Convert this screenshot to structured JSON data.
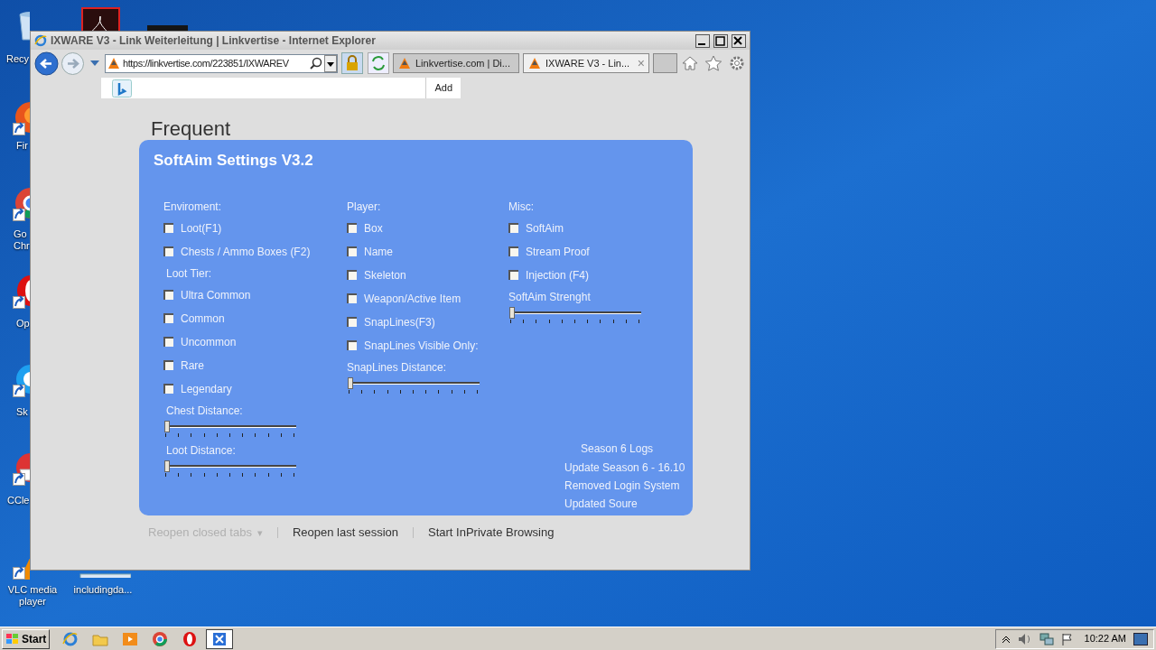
{
  "desktop": {
    "icons": [
      {
        "kind": "bin",
        "label": "Recy",
        "shortcut": false
      },
      {
        "kind": "pdf",
        "shortcut": false
      },
      {
        "kind": "dark",
        "shortcut": false
      },
      {
        "kind": "fox",
        "label": "Fir",
        "shortcut": true
      },
      {
        "kind": "ring",
        "label": "Go Chr",
        "shortcut": true
      },
      {
        "kind": "o",
        "label": "Op",
        "shortcut": true
      },
      {
        "kind": "bubble",
        "label": "Sk",
        "shortcut": true
      },
      {
        "kind": "broom",
        "label": "CCle",
        "shortcut": true
      },
      {
        "kind": "cone",
        "label": "VLC media player",
        "shortcut": true
      },
      {
        "kind": "document",
        "label": "includingda...",
        "shortcut": false
      }
    ]
  },
  "browser": {
    "title": "IXWARE V3 - Link Weiterleitung | Linkvertise - Internet Explorer",
    "address": "https://linkvertise.com/223851/IXWAREV",
    "tabs": [
      {
        "label": "Linkvertise.com | Di...",
        "selected": false
      },
      {
        "label": "IXWARE V3 - Lin...",
        "selected": true,
        "close": "×"
      }
    ],
    "search_bar": {
      "button": "Add"
    },
    "page": {
      "heading": "Frequent",
      "links": [
        {
          "label": "Reopen closed tabs",
          "disabled": true,
          "caret": "▾"
        },
        {
          "label": "Reopen last session",
          "disabled": false
        },
        {
          "label": "Start InPrivate Browsing",
          "disabled": false
        }
      ]
    }
  },
  "dialog": {
    "title": "SoftAim Settings V3.2",
    "columns": [
      [
        {
          "kind": "heading",
          "label": "Enviroment:"
        },
        {
          "kind": "checkbox",
          "label": "Loot(F1)",
          "checked": false
        },
        {
          "kind": "checkbox",
          "label": "Chests / Ammo Boxes (F2)",
          "checked": false
        },
        {
          "kind": "heading",
          "label": "Loot Tier:"
        },
        {
          "kind": "checkbox",
          "label": "Ultra Common",
          "checked": false
        },
        {
          "kind": "checkbox",
          "label": "Common",
          "checked": false
        },
        {
          "kind": "checkbox",
          "label": "Uncommon",
          "checked": false
        },
        {
          "kind": "checkbox",
          "label": "Rare",
          "checked": false
        },
        {
          "kind": "checkbox",
          "label": "Legendary",
          "checked": false
        },
        {
          "kind": "heading",
          "label": "Chest Distance:"
        },
        {
          "kind": "slider",
          "level": 0
        },
        {
          "kind": "heading",
          "label": "Loot Distance:"
        },
        {
          "kind": "slider",
          "level": 0
        }
      ],
      [
        {
          "kind": "heading",
          "label": "Player:"
        },
        {
          "kind": "checkbox",
          "label": "Box",
          "checked": false
        },
        {
          "kind": "checkbox",
          "label": "Name",
          "checked": false
        },
        {
          "kind": "checkbox",
          "label": "Skeleton",
          "checked": false
        },
        {
          "kind": "checkbox",
          "label": "Weapon/Active Item",
          "checked": false
        },
        {
          "kind": "checkbox",
          "label": "SnapLines(F3)",
          "checked": false
        },
        {
          "kind": "checkbox",
          "label": "SnapLines Visible Only:",
          "checked": false
        },
        {
          "kind": "heading",
          "label": "SnapLines Distance:"
        },
        {
          "kind": "slider",
          "level": 0
        }
      ],
      [
        {
          "kind": "heading",
          "label": "Misc:"
        },
        {
          "kind": "checkbox",
          "label": "SoftAim",
          "checked": false
        },
        {
          "kind": "checkbox",
          "label": "Stream Proof",
          "checked": false
        },
        {
          "kind": "checkbox",
          "label": "Injection (F4)",
          "checked": false
        },
        {
          "kind": "heading",
          "label": "SoftAim Strenght"
        },
        {
          "kind": "slider",
          "level": 0
        }
      ]
    ],
    "logs": {
      "title": "Season 6 Logs",
      "lines": [
        "Update Season 6 - 16.10",
        "Removed Login System",
        "Updated Soure"
      ]
    }
  },
  "taskbar": {
    "start": "Start",
    "items": [
      {
        "kind": "ie",
        "selected": false
      },
      {
        "kind": "folder",
        "selected": false
      },
      {
        "kind": "media",
        "selected": false
      },
      {
        "kind": "ring",
        "selected": false
      },
      {
        "kind": "o",
        "selected": false
      },
      {
        "kind": "x",
        "selected": true
      }
    ],
    "clock": "10:22 AM"
  }
}
